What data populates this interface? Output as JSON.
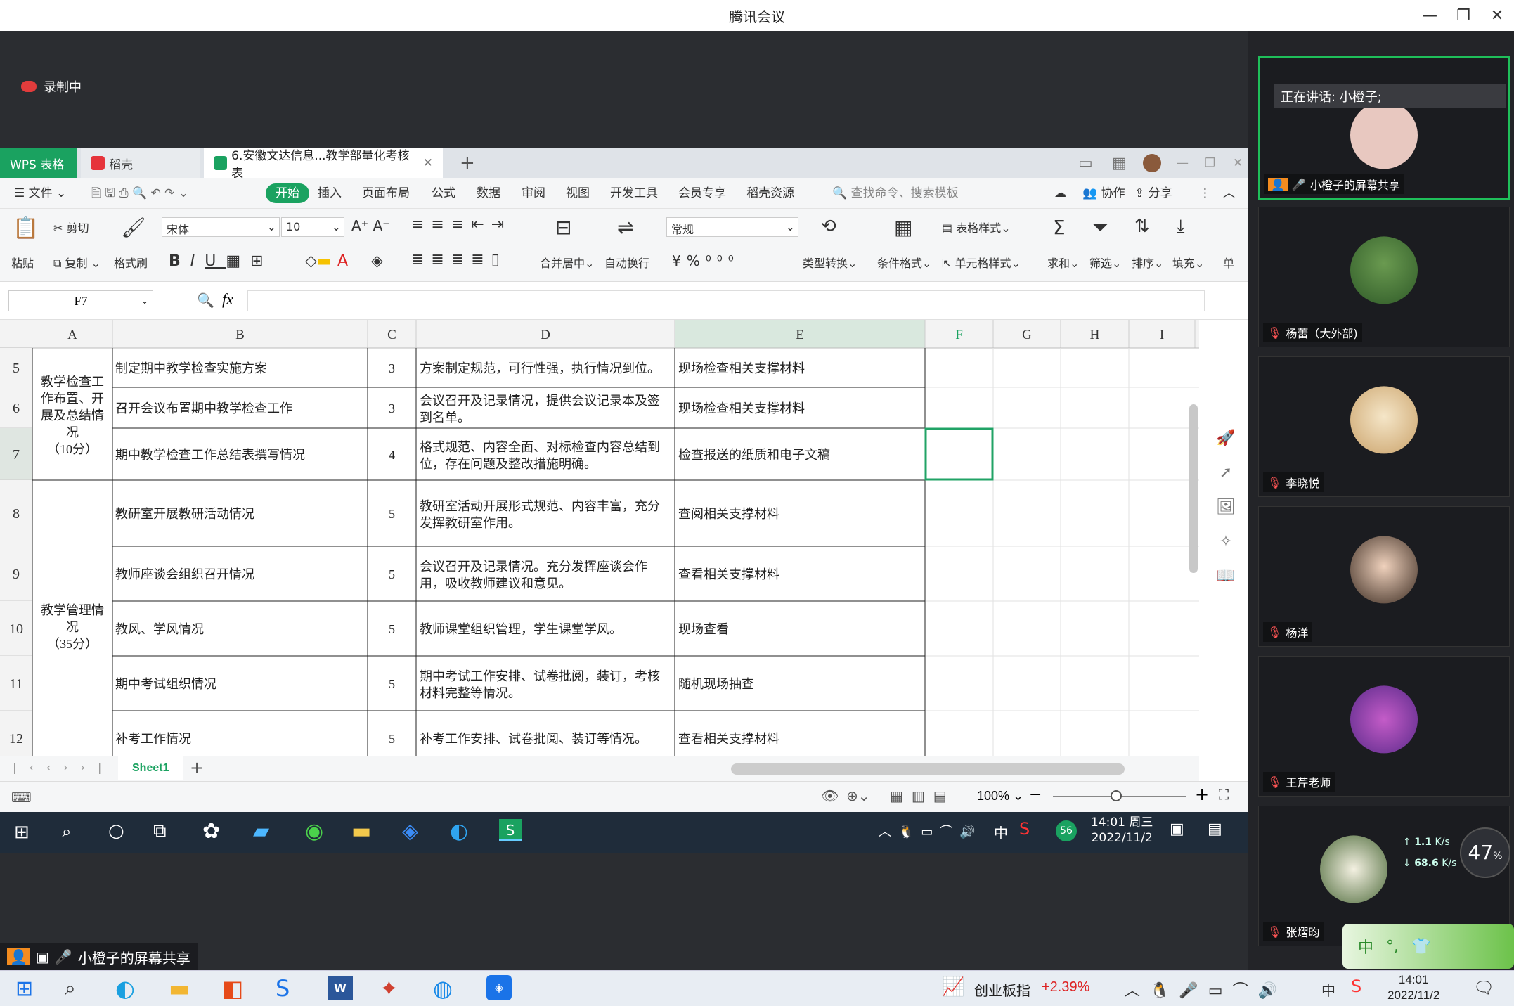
{
  "app_title": "腾讯会议",
  "recording_label": "录制中",
  "wps": {
    "tabs": {
      "wps": "WPS 表格",
      "daoke": "稻壳",
      "file": "6.安徽文达信息...教学部量化考核表"
    },
    "menu": {
      "file": "文件",
      "items": [
        "开始",
        "插入",
        "页面布局",
        "公式",
        "数据",
        "审阅",
        "视图",
        "开发工具",
        "会员专享",
        "稻壳资源"
      ],
      "search": "查找命令、搜索模板",
      "collab": "协作",
      "share": "分享"
    },
    "toolbar": {
      "paste": "粘贴",
      "cut": "剪切",
      "copy": "复制",
      "format_painter": "格式刷",
      "font": "宋体",
      "size": "10",
      "merge": "合并居中",
      "wrap": "自动换行",
      "number_format": "常规",
      "convert": "类型转换",
      "cond_format": "条件格式",
      "table_style": "表格样式",
      "cell_style": "单元格样式",
      "sum": "求和",
      "filter": "筛选",
      "sort": "排序",
      "fill": "填充",
      "more": "单"
    },
    "name_box": "F7",
    "fx": "fx",
    "columns": [
      "A",
      "B",
      "C",
      "D",
      "E",
      "F",
      "G",
      "H",
      "I"
    ],
    "rows": [
      {
        "n": "5",
        "b": "制定期中教学检查实施方案",
        "c": "3",
        "d": "方案制定规范，可行性强，执行情况到位。",
        "e": "现场检查相关支撑材料"
      },
      {
        "n": "6",
        "b": "召开会议布置期中教学检查工作",
        "c": "3",
        "d1": "会议召开及记录情况，提供会议记录本及签",
        "d2": "到名单。",
        "e": "现场检查相关支撑材料"
      },
      {
        "n": "7",
        "b": "期中教学检查工作总结表撰写情况",
        "c": "4",
        "d1": "格式规范、内容全面、对标检查内容总结到",
        "d2": "位，存在问题及整改措施明确。",
        "e": "检查报送的纸质和电子文稿"
      },
      {
        "n": "8",
        "b": "教研室开展教研活动情况",
        "c": "5",
        "d1": "教研室活动开展形式规范、内容丰富，充分",
        "d2": "发挥教研室作用。",
        "e": "查阅相关支撑材料"
      },
      {
        "n": "9",
        "b": "教师座谈会组织召开情况",
        "c": "5",
        "d1": "会议召开及记录情况。充分发挥座谈会作",
        "d2": "用，吸收教师建议和意见。",
        "e": "查看相关支撑材料"
      },
      {
        "n": "10",
        "b": "教风、学风情况",
        "c": "5",
        "d": "教师课堂组织管理，学生课堂学风。",
        "e": "现场查看"
      },
      {
        "n": "11",
        "b": "期中考试组织情况",
        "c": "5",
        "d1": "期中考试工作安排、试卷批阅，装订，考核",
        "d2": "材料完整等情况。",
        "e": "随机现场抽查"
      },
      {
        "n": "12",
        "b": "补考工作情况",
        "c": "5",
        "d": "补考工作安排、试卷批阅、装订等情况。",
        "e": "查看相关支撑材料"
      }
    ],
    "merged_a1": [
      "教学检查工",
      "作布置、开",
      "展及总结情",
      "况",
      "（10分）"
    ],
    "merged_a2": [
      "教学管理情",
      "况",
      "（35分）"
    ],
    "sheet_tab": "Sheet1",
    "zoom": "100%",
    "clock_time": "14:01 周三",
    "clock_date": "2022/11/2",
    "ime": "中",
    "badge": "56"
  },
  "participants": {
    "speaking": "正在讲话: 小橙子;",
    "screen_share_tile": "小橙子的屏幕共享",
    "list": [
      "杨蕾（大外部)",
      "李晓悦",
      "杨洋",
      "王芹老师",
      "张熠昀"
    ]
  },
  "network": {
    "up": "1.1",
    "up_unit": "K/s",
    "down": "68.6",
    "down_unit": "K/s",
    "cpu": "47",
    "cpu_unit": "%"
  },
  "share_label": "小橙子的屏幕共享",
  "bottom": {
    "stock_name": "创业板指",
    "stock_change": "+2.39%",
    "ime": "中",
    "time": "14:01",
    "date": "2022/11/2"
  },
  "colors": {
    "accent_green": "#1aa260",
    "selected": "#21a366"
  }
}
